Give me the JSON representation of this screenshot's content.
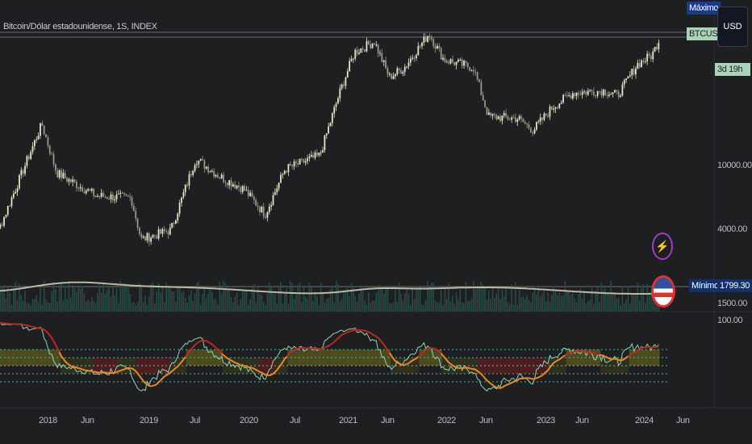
{
  "header": {
    "symbol_title": "Bitcoin/Dólar estadounidense, 1S, INDEX"
  },
  "price_scale": {
    "currency_button": "USD",
    "max_label": "Máximo",
    "symbol_tag": "BTCUSD",
    "countdown": "3d 19h",
    "min_label": "Mínimo",
    "min_value": "1799.30",
    "ticks": [
      "10000.00",
      "4000.00",
      "1500.00"
    ],
    "rsi_tick": "100.00"
  },
  "colors": {
    "background": "#1e1f21",
    "candle": "#e8e2c8",
    "rsi": "#8fd3b6",
    "rsi_ma": "#f08a24",
    "rsi_ma_high": "#c0281e",
    "max_tag": "#1a3a8c",
    "min_tag": "#123070",
    "symbol_tag": "#a9d4b8"
  },
  "chart_data": {
    "type": "candlestick",
    "title": "Bitcoin/Dólar estadounidense, 1S, INDEX",
    "y_scale": "log",
    "x_ticks": [
      "2018",
      "Jun",
      "2019",
      "Jul",
      "2020",
      "Jul",
      "2021",
      "Jun",
      "2022",
      "Jun",
      "2023",
      "Jun",
      "2024",
      "Jun"
    ],
    "price_path": [
      [
        2017.3,
        1900
      ],
      [
        2017.95,
        18000
      ],
      [
        2018.1,
        9000
      ],
      [
        2018.5,
        6500
      ],
      [
        2018.85,
        6300
      ],
      [
        2018.95,
        3500
      ],
      [
        2019.25,
        4000
      ],
      [
        2019.5,
        11000
      ],
      [
        2019.75,
        8500
      ],
      [
        2019.98,
        7200
      ],
      [
        2020.2,
        5000
      ],
      [
        2020.4,
        9500
      ],
      [
        2020.75,
        11500
      ],
      [
        2020.95,
        28000
      ],
      [
        2021.1,
        50000
      ],
      [
        2021.3,
        58000
      ],
      [
        2021.45,
        35000
      ],
      [
        2021.6,
        40000
      ],
      [
        2021.85,
        65000
      ],
      [
        2022.0,
        45000
      ],
      [
        2022.3,
        40000
      ],
      [
        2022.45,
        20000
      ],
      [
        2022.75,
        19500
      ],
      [
        2022.9,
        16500
      ],
      [
        2023.1,
        23000
      ],
      [
        2023.3,
        28000
      ],
      [
        2023.6,
        29000
      ],
      [
        2023.75,
        27000
      ],
      [
        2023.95,
        42000
      ],
      [
        2024.1,
        48000
      ],
      [
        2024.18,
        62000
      ]
    ],
    "min_price": 1799.3,
    "rsi_levels": [
      70,
      60,
      50,
      40,
      30
    ]
  }
}
